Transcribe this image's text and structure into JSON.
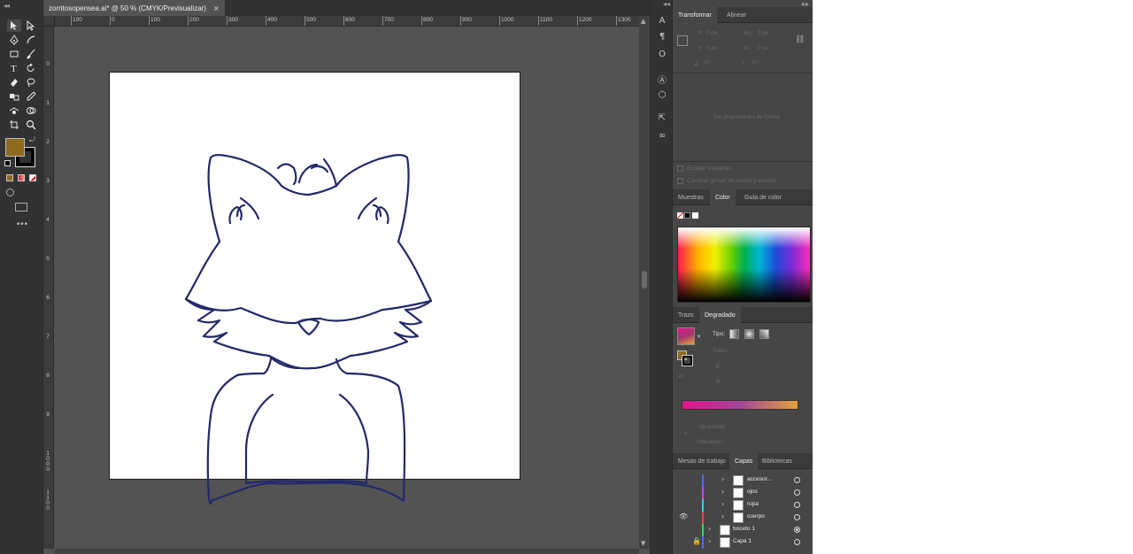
{
  "document": {
    "tab_title": "zorritosopensea.ai* @ 50 % (CMYK/Previsualizar)",
    "close_glyph": "×"
  },
  "rulers": {
    "horizontal": [
      "100",
      "0",
      "100",
      "200",
      "300",
      "400",
      "500",
      "600",
      "700",
      "800",
      "900",
      "1000",
      "1100",
      "1200",
      "1300"
    ],
    "vertical": [
      "0",
      "1",
      "2",
      "3",
      "4",
      "5",
      "6",
      "7",
      "8",
      "9",
      "1000",
      "1100"
    ]
  },
  "colors": {
    "fill": "#8e6b1e",
    "stroke": "#000000",
    "fox_stroke": "#23286b",
    "gradient_start": "#e0158a",
    "gradient_end": "#e3a338"
  },
  "toolbar": {
    "tools": [
      "selection-tool",
      "direct-selection-tool",
      "pen-tool",
      "curvature-tool",
      "rectangle-tool",
      "paintbrush-tool",
      "type-tool",
      "rotate-tool",
      "eraser-tool",
      "lasso-tool",
      "blend-tool",
      "eyedropper-tool",
      "puppet-warp-tool",
      "shape-builder-tool",
      "artboard-tool",
      "zoom-tool"
    ],
    "more": "•••"
  },
  "panels": {
    "transform": {
      "tabs": [
        "Transformar",
        "Alinear"
      ],
      "x": "0 px",
      "y": "0 px",
      "w": "0 px",
      "h": "0 px",
      "x_label": "X:",
      "y_label": "Y:",
      "w_label": "An.:",
      "h_label": "Al.:",
      "angle": "0°",
      "shear": "0°",
      "empty_text": "Sin propiedades de forma",
      "scale_strokes": "Escalar esquinas",
      "scale_effects": "Cambiar grosor de trazos y efectos"
    },
    "color": {
      "tabs": [
        "Muestras",
        "Color",
        "Guía de color"
      ]
    },
    "gradient": {
      "tabs": [
        "Trazo",
        "Degradado"
      ],
      "type_label": "Tipo:",
      "stroke_label": "Trazo:",
      "opacity_label": "Opacidad:",
      "location_label": "Ubicación:"
    },
    "layers": {
      "tabs": [
        "Mesas de trabajo",
        "Capas",
        "Bibliotecas"
      ],
      "items": [
        {
          "name": "accesor...",
          "color": "#4a6cf0"
        },
        {
          "name": "ojos",
          "color": "#c04ae0"
        },
        {
          "name": "ropa",
          "color": "#34d0e0"
        },
        {
          "name": "cuerpo",
          "color": "#e04a4a"
        },
        {
          "name": "boceto 1",
          "color": "#4ad04a"
        },
        {
          "name": "Capa 1",
          "color": "#4a6cf0"
        }
      ]
    }
  }
}
